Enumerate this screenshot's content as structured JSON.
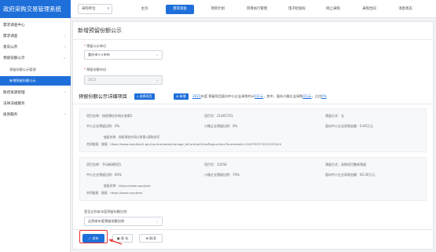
{
  "app": {
    "title": "政府采购交易管理系统"
  },
  "header": {
    "unit_selector": "采购单位",
    "nav": [
      "主页",
      "需求调查",
      "项目计划",
      "项目执行管理",
      "电子招投标",
      "网上采购",
      "采购合同",
      "消息状态"
    ],
    "active_index": 1
  },
  "sidebar": {
    "items": [
      {
        "label": "需求调查中心",
        "arrow": false,
        "sub": false,
        "active": false
      },
      {
        "label": "需求调查",
        "arrow": true,
        "sub": false,
        "active": false
      },
      {
        "label": "意向公开",
        "arrow": true,
        "sub": false,
        "active": false
      },
      {
        "label": "预留份额公示",
        "arrow": true,
        "sub": false,
        "active": false
      },
      {
        "label": "预留份额公示管理",
        "arrow": false,
        "sub": true,
        "active": false
      },
      {
        "label": "新增预留份额公示",
        "arrow": false,
        "sub": true,
        "active": true
      },
      {
        "label": "政府资源管理",
        "arrow": true,
        "sub": false,
        "active": false
      },
      {
        "label": "法律法规服务",
        "arrow": false,
        "sub": false,
        "active": false
      },
      {
        "label": "投资服务",
        "arrow": true,
        "sub": false,
        "active": false
      }
    ]
  },
  "main": {
    "title": "新增预留份额公示",
    "fields": [
      {
        "label": "预留公示单位",
        "value": "重庆市××市市"
      },
      {
        "label": "预留份额年份",
        "value": "2021"
      }
    ],
    "section_title": "预留份额公示详细项目",
    "btn_select": "选择项目",
    "btn_add": "新增",
    "summary": {
      "year": "2021",
      "t1": "年度 预留项目面向中小企业采购共计",
      "a1": "0万元",
      "t2": "，其中，面向小微企业采购",
      "a2": "0万元",
      "t3": "，占比",
      "pct": "0%"
    },
    "cards": [
      {
        "name": "项目名称：授权预估外网计划第2",
        "code": "项目号：21A01701",
        "method": "预留方式：无",
        "sme_pct": "中小企业预留比例：0%",
        "small_pct": "小微企业预留比例：0%",
        "amount": "面向中小企业采购金额：0.00万元",
        "linkname": "链接名称：授权预估外网计划第2采购合同",
        "link": "合同链接：链接：https://www.cqzcjtest1.gov/contractpost/manage_toContractViewPage.action?businessId=1045787275222553424"
      },
      {
        "name": "项目名称：手动新增项目",
        "code": "项目号：12456",
        "method": "预留方式：采购项目整体预留",
        "sme_pct": "中小企业预留比例：60%",
        "small_pct": "小微企业预留比例：70%",
        "amount": "面向中小企业采购金额：65.00万元",
        "linkname": "链接名称：https://www.cqzcjtest",
        "link": "合同链接：链接：https://www.cqzcjtest"
      }
    ],
    "ratio": {
      "label": "是否达到本年度预留份额比例",
      "value": "达到本年度预留份额比例"
    },
    "buttons": {
      "publish": "发布",
      "save": "保 存",
      "cancel": "取消"
    }
  },
  "colors": {
    "primary": "#1e6fd9",
    "highlight": "#e33333"
  }
}
